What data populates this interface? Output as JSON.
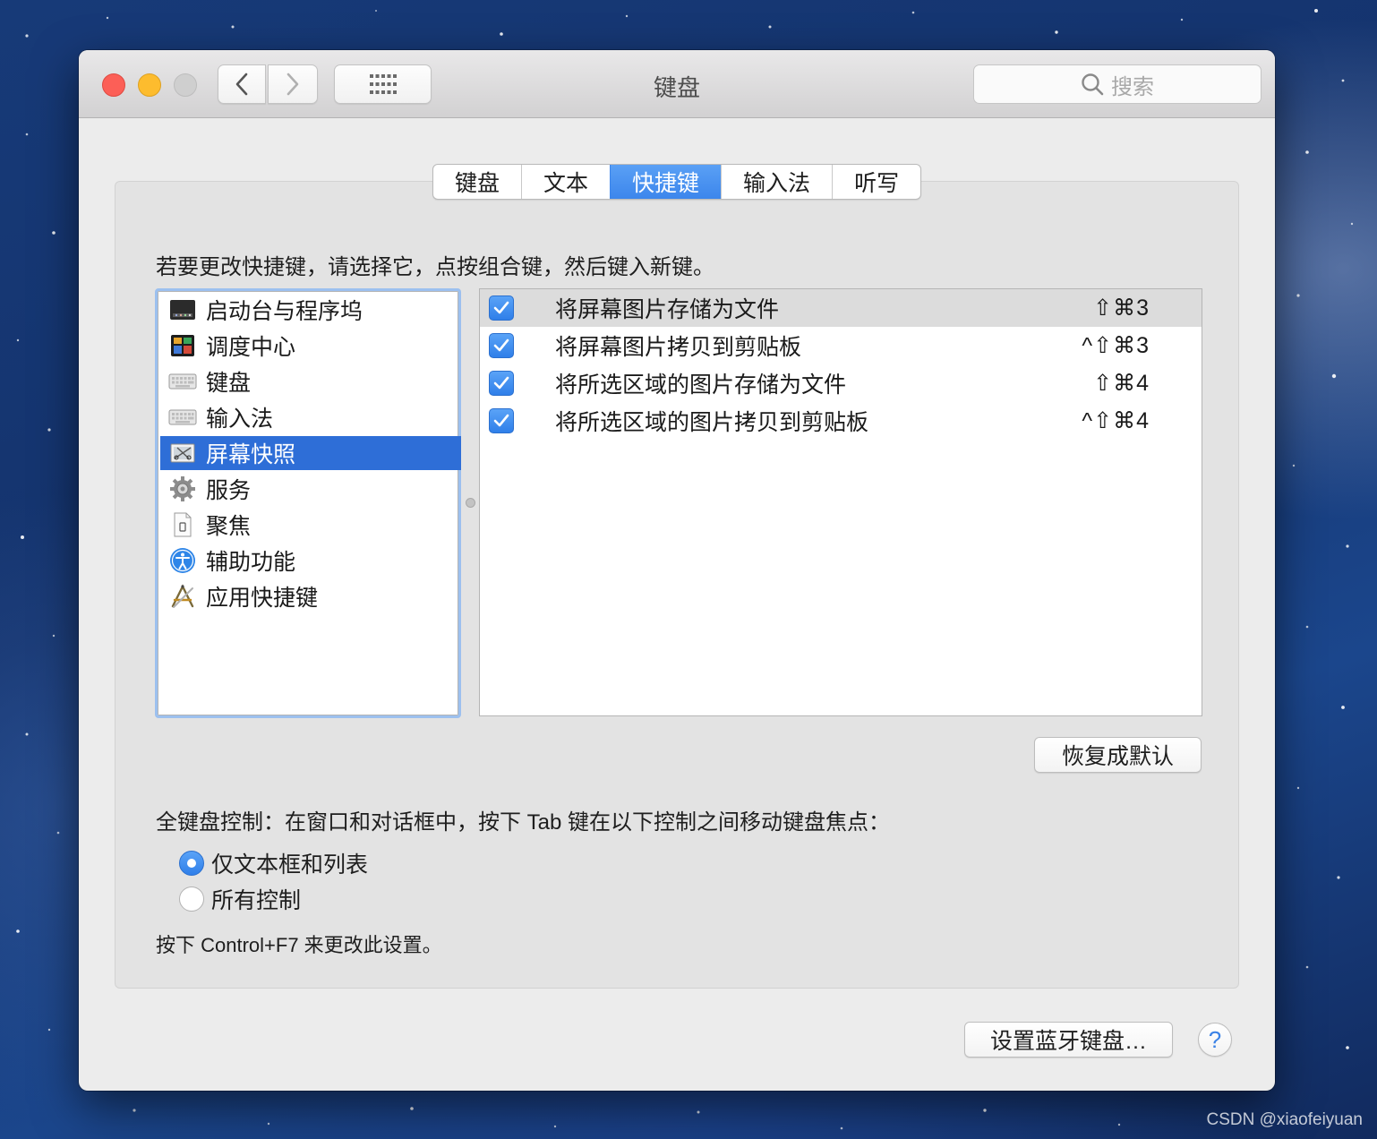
{
  "window": {
    "title": "键盘"
  },
  "toolbar": {
    "search_placeholder": "搜索"
  },
  "tabs": [
    {
      "label": "键盘",
      "active": false
    },
    {
      "label": "文本",
      "active": false
    },
    {
      "label": "快捷键",
      "active": true
    },
    {
      "label": "输入法",
      "active": false
    },
    {
      "label": "听写",
      "active": false
    }
  ],
  "instruction": "若要更改快捷键，请选择它，点按组合键，然后键入新键。",
  "categories": [
    {
      "label": "启动台与程序坞",
      "icon": "dock-icon",
      "selected": false
    },
    {
      "label": "调度中心",
      "icon": "mission-control-icon",
      "selected": false
    },
    {
      "label": "键盘",
      "icon": "keyboard-icon",
      "selected": false
    },
    {
      "label": "输入法",
      "icon": "keyboard-icon",
      "selected": false
    },
    {
      "label": "屏幕快照",
      "icon": "screenshot-icon",
      "selected": true
    },
    {
      "label": "服务",
      "icon": "gear-icon",
      "selected": false
    },
    {
      "label": "聚焦",
      "icon": "document-icon",
      "selected": false
    },
    {
      "label": "辅助功能",
      "icon": "accessibility-icon",
      "selected": false
    },
    {
      "label": "应用快捷键",
      "icon": "app-store-icon",
      "selected": false
    }
  ],
  "shortcuts": [
    {
      "checked": true,
      "label": "将屏幕图片存储为文件",
      "keys": "⇧⌘3",
      "selected": true
    },
    {
      "checked": true,
      "label": "将屏幕图片拷贝到剪贴板",
      "keys": "^⇧⌘3",
      "selected": false
    },
    {
      "checked": true,
      "label": "将所选区域的图片存储为文件",
      "keys": "⇧⌘4",
      "selected": false
    },
    {
      "checked": true,
      "label": "将所选区域的图片拷贝到剪贴板",
      "keys": "^⇧⌘4",
      "selected": false
    }
  ],
  "restore_button": "恢复成默认",
  "full_keyboard_control": {
    "label": "全键盘控制：在窗口和对话框中，按下 Tab 键在以下控制之间移动键盘焦点：",
    "options": [
      {
        "label": "仅文本框和列表",
        "selected": true
      },
      {
        "label": "所有控制",
        "selected": false
      }
    ],
    "hint": "按下 Control+F7 来更改此设置。"
  },
  "bluetooth_button": "设置蓝牙键盘…",
  "help_button": "?",
  "watermark": "CSDN @xiaofeiyuan",
  "colors": {
    "accent": "#2e6ed7",
    "tab_active": "#3c86ec",
    "checkbox": "#3b86ee"
  }
}
